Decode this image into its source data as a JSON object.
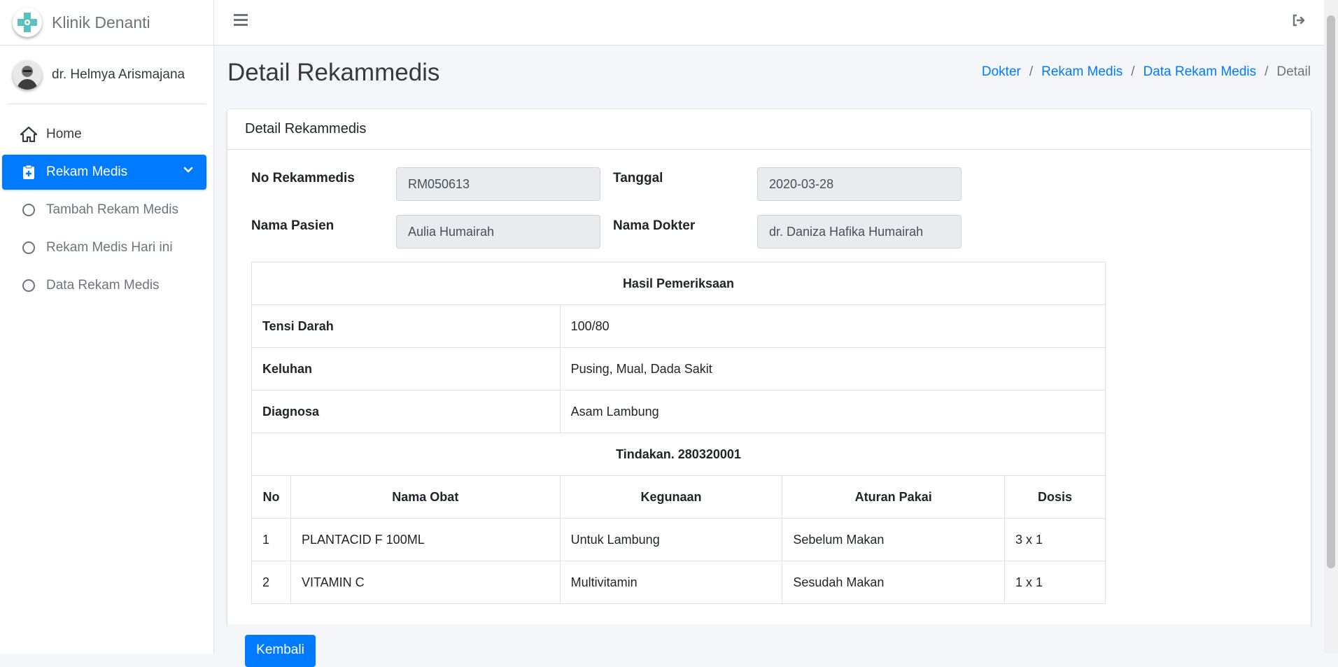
{
  "app": {
    "brand": "Klinik Denanti"
  },
  "user": {
    "name": "dr. Helmya Arismajana"
  },
  "sidebar": {
    "items": [
      {
        "label": "Home",
        "icon": "home-icon"
      },
      {
        "label": "Rekam Medis",
        "icon": "clipboard-medical-icon",
        "active": true
      },
      {
        "label": "Tambah Rekam Medis",
        "icon": "circle-icon"
      },
      {
        "label": "Rekam Medis Hari ini",
        "icon": "circle-icon"
      },
      {
        "label": "Data Rekam Medis",
        "icon": "circle-icon"
      }
    ]
  },
  "page": {
    "title": "Detail Rekammedis",
    "breadcrumb": [
      "Dokter",
      "Rekam Medis",
      "Data Rekam Medis",
      "Detail"
    ]
  },
  "card": {
    "header": "Detail Rekammedis",
    "fields": {
      "no_rekammedis_label": "No Rekammedis",
      "no_rekammedis_value": "RM050613",
      "tanggal_label": "Tanggal",
      "tanggal_value": "2020-03-28",
      "nama_pasien_label": "Nama Pasien",
      "nama_pasien_value": "Aulia Humairah",
      "nama_dokter_label": "Nama Dokter",
      "nama_dokter_value": "dr. Daniza Hafika Humairah"
    },
    "hasil": {
      "title": "Hasil Pemeriksaan",
      "rows": [
        {
          "label": "Tensi Darah",
          "value": "100/80"
        },
        {
          "label": "Keluhan",
          "value": "Pusing, Mual, Dada Sakit"
        },
        {
          "label": "Diagnosa",
          "value": "Asam Lambung"
        }
      ]
    },
    "tindakan": {
      "title": "Tindakan. 280320001",
      "headers": [
        "No",
        "Nama Obat",
        "Kegunaan",
        "Aturan Pakai",
        "Dosis"
      ],
      "rows": [
        [
          "1",
          "PLANTACID F 100ML",
          "Untuk Lambung",
          "Sebelum Makan",
          "3 x 1"
        ],
        [
          "2",
          "VITAMIN C",
          "Multivitamin",
          "Sesudah Makan",
          "1 x 1"
        ]
      ]
    },
    "back_button": "Kembali"
  },
  "colors": {
    "primary": "#007bff",
    "background": "#f4f6f9"
  }
}
